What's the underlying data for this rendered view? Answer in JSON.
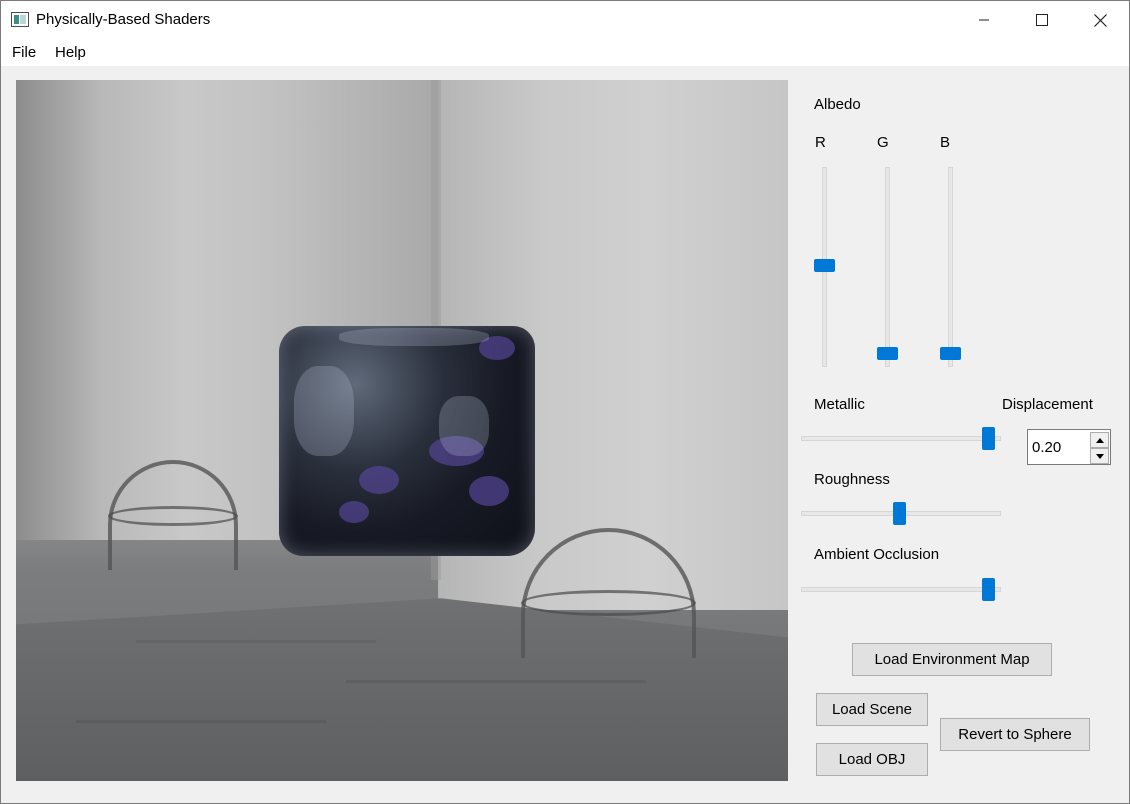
{
  "window": {
    "title": "Physically-Based Shaders",
    "controls": {
      "minimize_icon": "minimize-icon",
      "maximize_icon": "maximize-icon",
      "close_icon": "close-icon"
    }
  },
  "menu": {
    "items": [
      "File",
      "Help"
    ]
  },
  "viewport": {
    "description_icon": "render-viewport"
  },
  "panel": {
    "albedo": {
      "label": "Albedo",
      "channels": [
        {
          "label": "R",
          "value": 0.51
        },
        {
          "label": "G",
          "value": 0.04
        },
        {
          "label": "B",
          "value": 0.04
        }
      ]
    },
    "metallic": {
      "label": "Metallic",
      "value": 0.97
    },
    "displacement": {
      "label": "Displacement",
      "value": "0.20"
    },
    "roughness": {
      "label": "Roughness",
      "value": 0.49
    },
    "ambient_occlusion": {
      "label": "Ambient Occlusion",
      "value": 0.97
    },
    "buttons": {
      "load_env_map": "Load Environment Map",
      "load_scene": "Load Scene",
      "load_obj": "Load OBJ",
      "revert_sphere": "Revert to Sphere"
    }
  },
  "colors": {
    "accent": "#0078d7",
    "background": "#f0f0f0",
    "button": "#e1e1e1"
  }
}
